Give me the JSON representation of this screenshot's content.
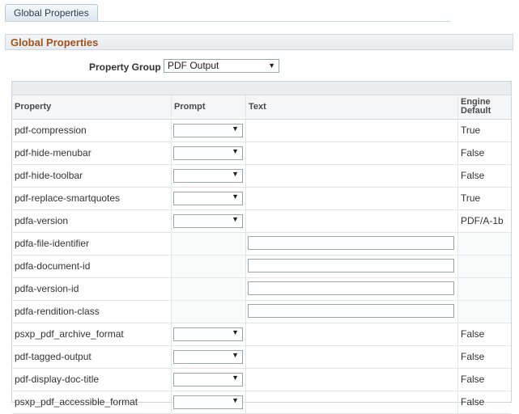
{
  "tab": {
    "label": "Global Properties"
  },
  "section": {
    "title": "Global Properties"
  },
  "property_group": {
    "label": "Property Group",
    "value": "PDF Output"
  },
  "grid": {
    "headers": {
      "property": "Property",
      "prompt": "Prompt",
      "text": "Text",
      "engine_default": "Engine Default"
    },
    "rows": [
      {
        "property": "pdf-compression",
        "control": "dropdown",
        "engine_default": "True"
      },
      {
        "property": "pdf-hide-menubar",
        "control": "dropdown",
        "engine_default": "False"
      },
      {
        "property": "pdf-hide-toolbar",
        "control": "dropdown",
        "engine_default": "False"
      },
      {
        "property": "pdf-replace-smartquotes",
        "control": "dropdown",
        "engine_default": "True"
      },
      {
        "property": "pdfa-version",
        "control": "dropdown",
        "engine_default": "PDF/A-1b"
      },
      {
        "property": "pdfa-file-identifier",
        "control": "text",
        "engine_default": ""
      },
      {
        "property": "pdfa-document-id",
        "control": "text",
        "engine_default": ""
      },
      {
        "property": "pdfa-version-id",
        "control": "text",
        "engine_default": ""
      },
      {
        "property": "pdfa-rendition-class",
        "control": "text",
        "engine_default": ""
      },
      {
        "property": "psxp_pdf_archive_format",
        "control": "dropdown",
        "engine_default": "False"
      },
      {
        "property": "pdf-tagged-output",
        "control": "dropdown",
        "engine_default": "False"
      },
      {
        "property": "pdf-display-doc-title",
        "control": "dropdown",
        "engine_default": "False"
      },
      {
        "property": "psxp_pdf_accessible_format",
        "control": "dropdown",
        "engine_default": "False"
      }
    ]
  }
}
